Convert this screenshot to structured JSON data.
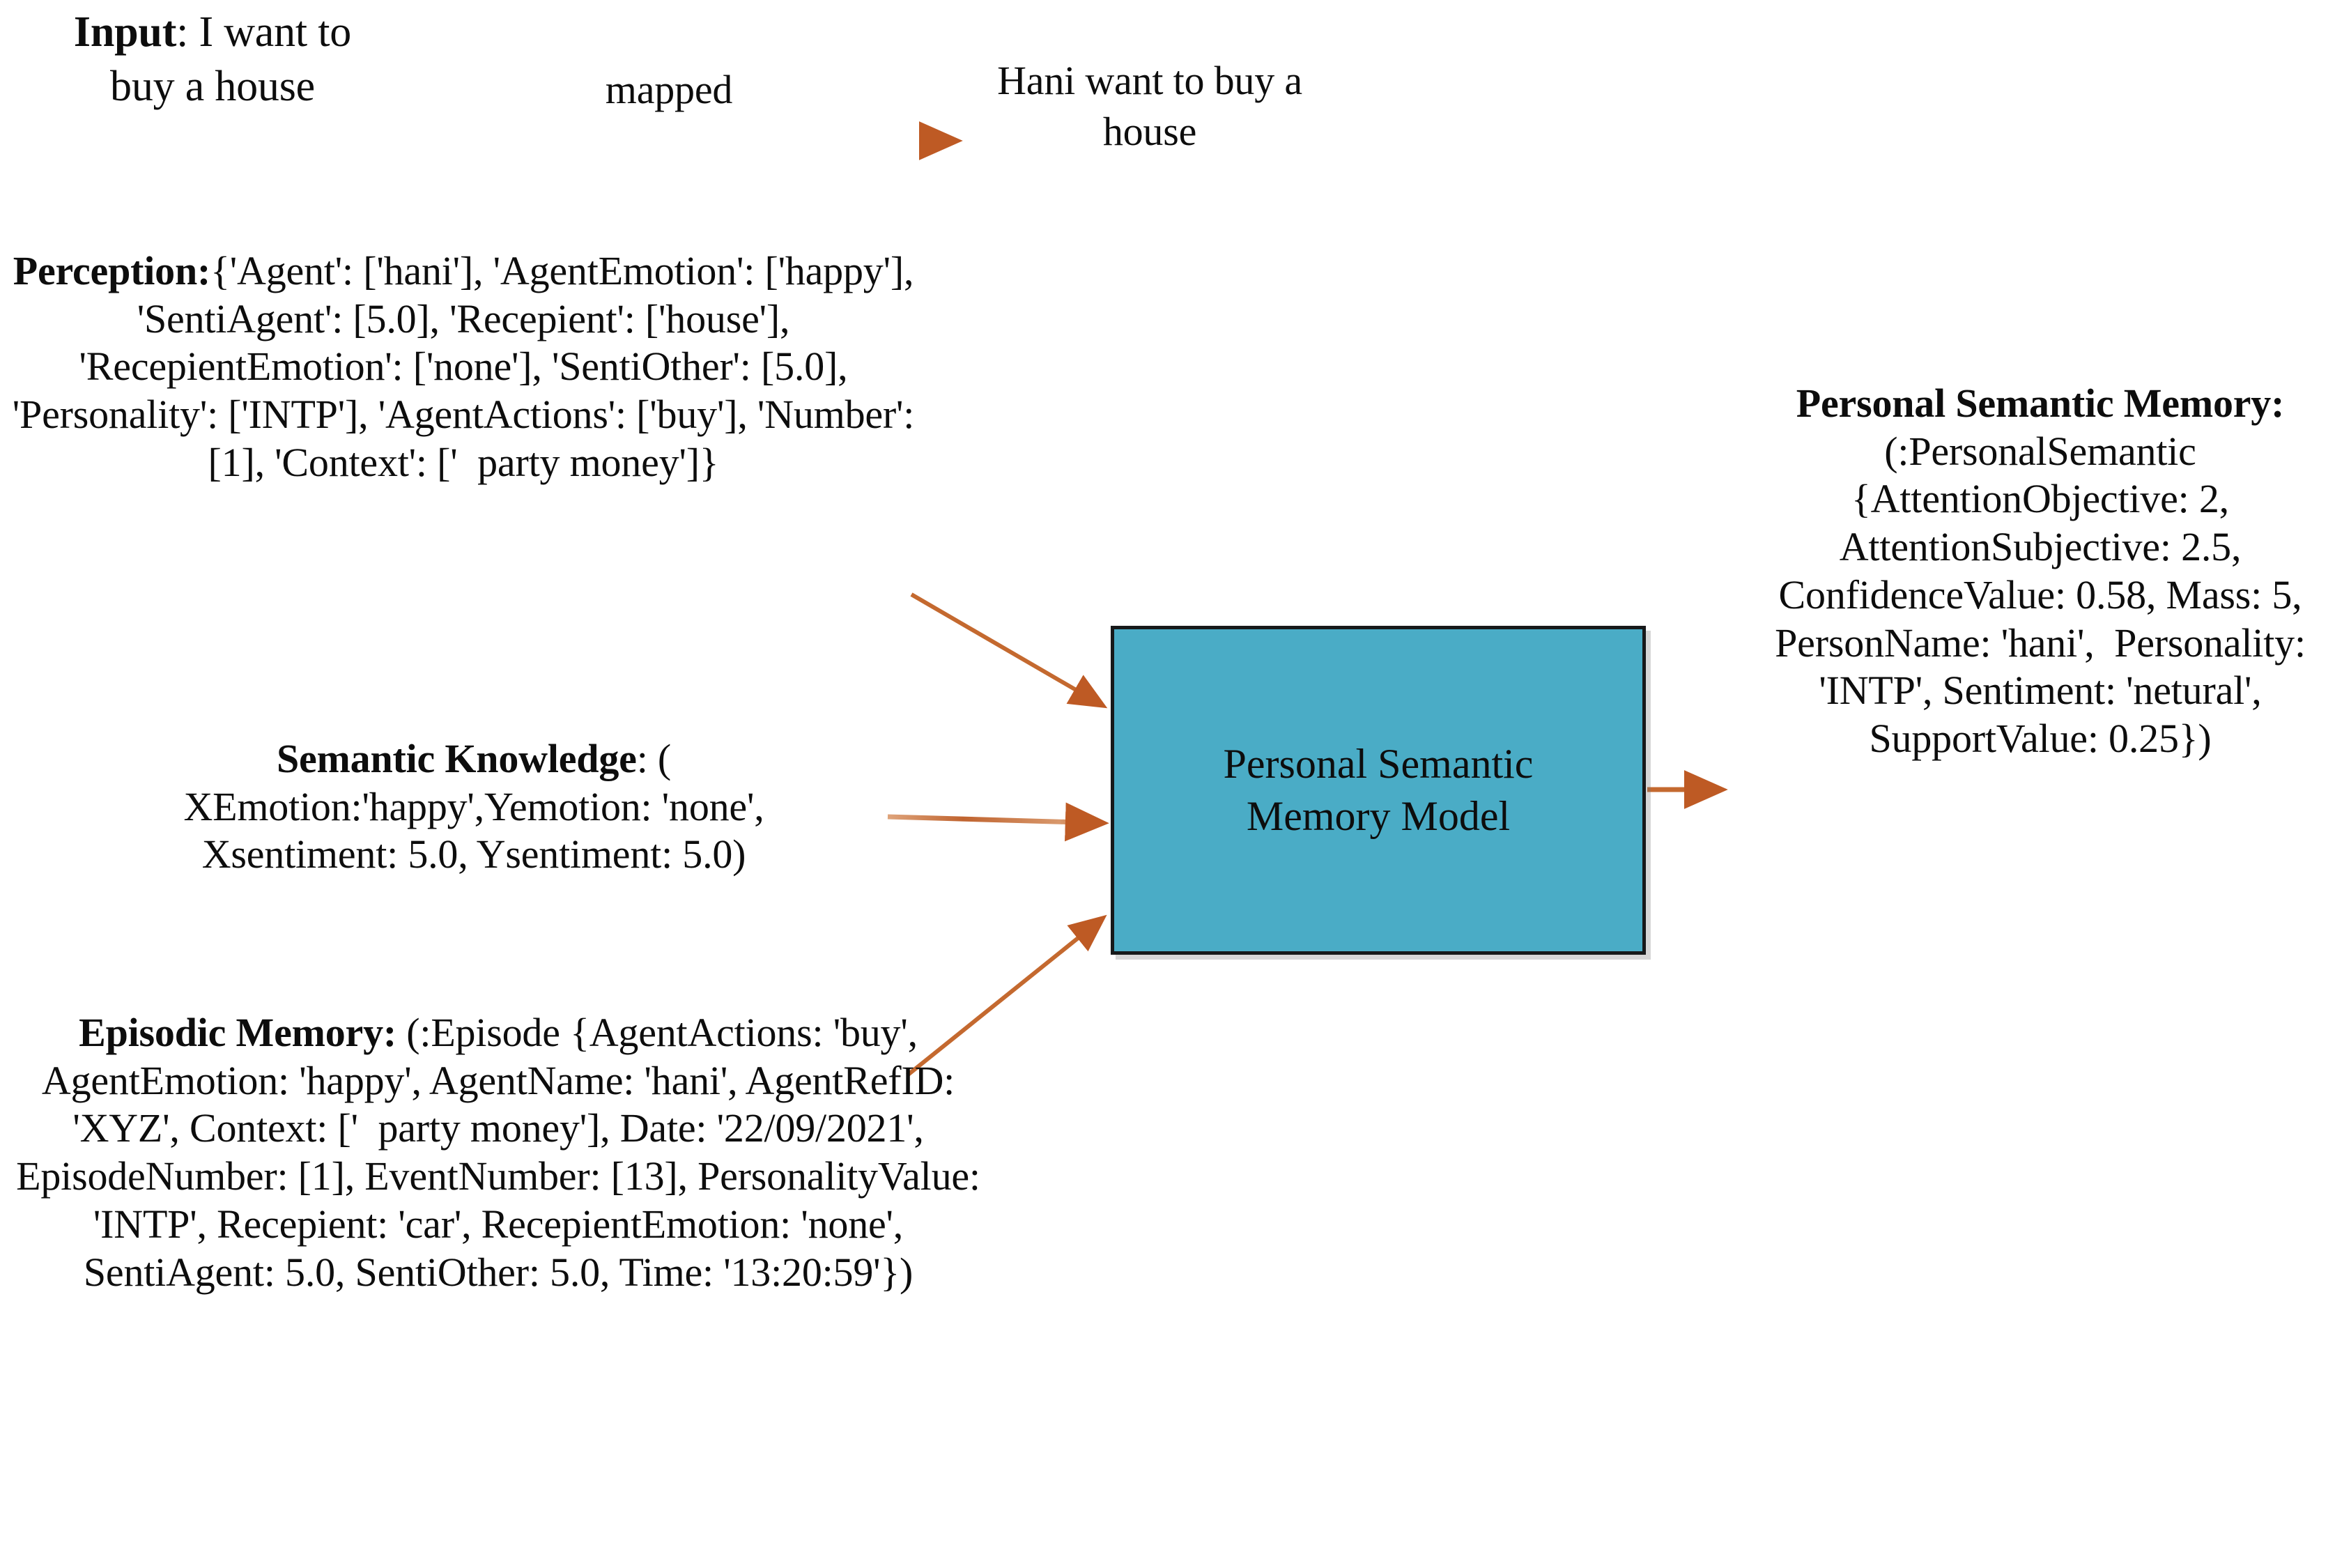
{
  "diagram": {
    "title": "Personal Semantic Memory Model pipeline",
    "colors": {
      "box_fill": "#4AACC6",
      "box_border": "#17191a",
      "arrow": "#BE5A24",
      "arrow_tail_light": "#D98E63",
      "text": "#0d0d0d",
      "background": "#ffffff"
    }
  },
  "input": {
    "label_bold": "Input",
    "text": "Input: I want to buy a house"
  },
  "mapping": {
    "edge_label": "mapped",
    "output_text": "Hani want to buy a house"
  },
  "perception": {
    "heading": "Perception:",
    "text": "Perception:{'Agent': ['hani'], 'AgentEmotion': ['happy'], 'SentiAgent': [5.0], 'Recepient': ['house'], 'RecepientEmotion': ['none'], 'SentiOther': [5.0], 'Personality': ['INTP'], 'AgentActions': ['buy'], 'Number': [1], 'Context': ['  party money']}",
    "fields": {
      "Agent": "['hani']",
      "AgentEmotion": "['happy']",
      "SentiAgent": "[5.0]",
      "Recepient": "['house']",
      "RecepientEmotion": "['none']",
      "SentiOther": "[5.0]",
      "Personality": "['INTP']",
      "AgentActions": "['buy']",
      "Number": "[1]",
      "Context": "['  party money']"
    }
  },
  "semantic_knowledge": {
    "heading": "Semantic Knowledge",
    "text": "Semantic Knowledge: ( XEmotion:'happy',Yemotion: 'none', Xsentiment: 5.0, Ysentiment: 5.0)",
    "fields": {
      "XEmotion": "'happy'",
      "Yemotion": "'none'",
      "Xsentiment": "5.0",
      "Ysentiment": "5.0"
    }
  },
  "episodic_memory": {
    "heading": "Episodic Memory:",
    "text": "Episodic Memory: (:Episode {AgentActions: 'buy', AgentEmotion: 'happy', AgentName: 'hani', AgentRefID: 'XYZ', Context: ['  party money'], Date: '22/09/2021', EpisodeNumber: [1], EventNumber: [13], PersonalityValue: 'INTP', Recepient: 'car', RecepientEmotion: 'none', SentiAgent: 5.0, SentiOther: 5.0, Time: '13:20:59'})",
    "fields": {
      "AgentActions": "'buy'",
      "AgentEmotion": "'happy'",
      "AgentName": "'hani'",
      "AgentRefID": "'XYZ'",
      "Context": "['  party money']",
      "Date": "'22/09/2021'",
      "EpisodeNumber": "[1]",
      "EventNumber": "[13]",
      "PersonalityValue": "'INTP'",
      "Recepient": "'car'",
      "RecepientEmotion": "'none'",
      "SentiAgent": "5.0",
      "SentiOther": "5.0",
      "Time": "'13:20:59'"
    }
  },
  "model_box": {
    "label": "Personal Semantic\nMemory Model"
  },
  "personal_semantic_memory": {
    "heading": "Personal Semantic Memory:",
    "text": "Personal Semantic Memory: (:PersonalSemantic {AttentionObjective: 2, AttentionSubjective: 2.5, ConfidenceValue: 0.58, Mass: 5, PersonName: 'hani',  Personality: 'INTP', Sentiment: 'netural', SupportValue: 0.25})",
    "fields": {
      "AttentionObjective": "2",
      "AttentionSubjective": "2.5",
      "ConfidenceValue": "0.58",
      "Mass": "5",
      "PersonName": "'hani'",
      "Personality": "'INTP'",
      "Sentiment": "'netural'",
      "SupportValue": "0.25"
    }
  },
  "arrows": [
    {
      "name": "mapped-arrow",
      "from": "input",
      "to": "mapped-output",
      "label": "mapped"
    },
    {
      "name": "perception-arrow",
      "from": "perception",
      "to": "model-box",
      "label": ""
    },
    {
      "name": "semantic-knowledge-arrow",
      "from": "semantic_knowledge",
      "to": "model-box",
      "label": ""
    },
    {
      "name": "episodic-memory-arrow",
      "from": "episodic_memory",
      "to": "model-box",
      "label": ""
    },
    {
      "name": "output-arrow",
      "from": "model-box",
      "to": "personal_semantic_memory",
      "label": ""
    }
  ]
}
